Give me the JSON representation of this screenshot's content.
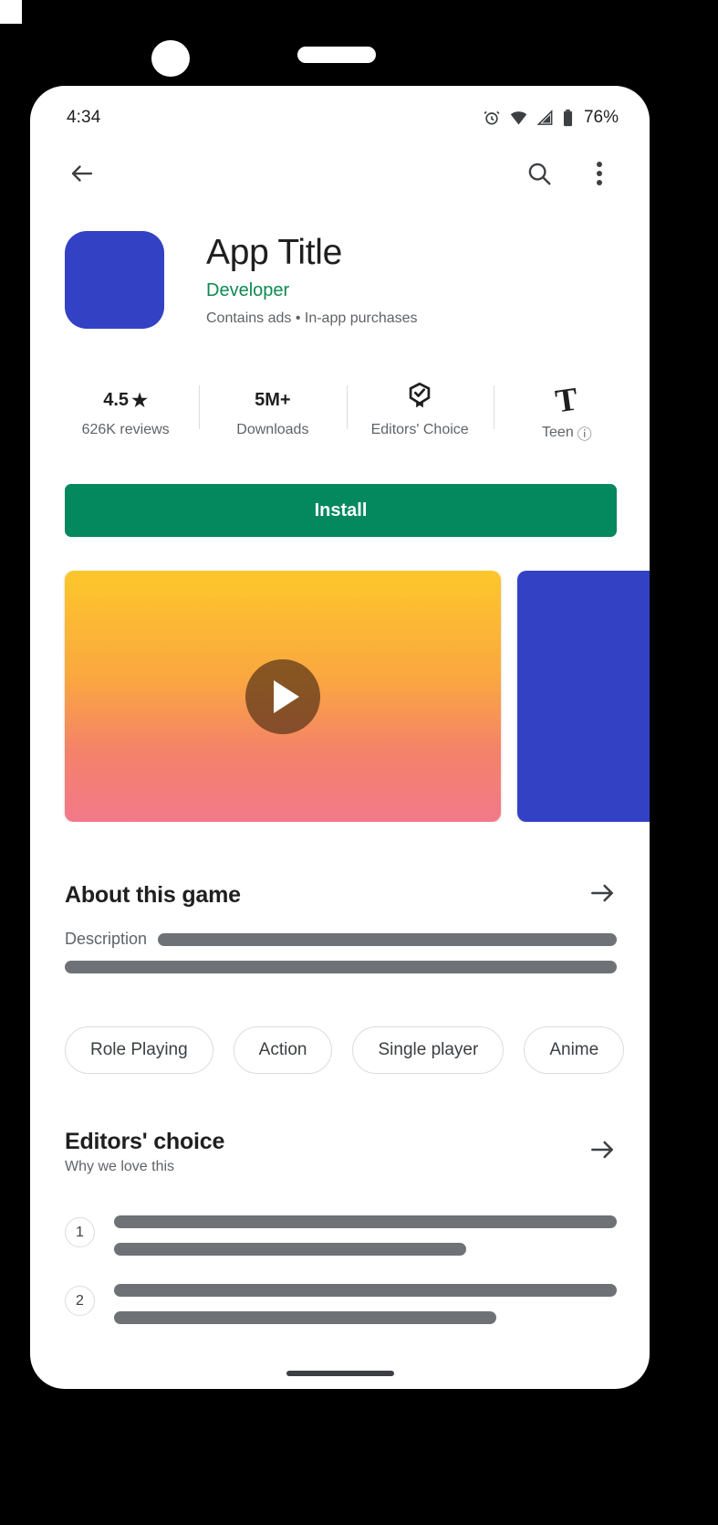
{
  "status_bar": {
    "time": "4:34",
    "battery_percent": "76%",
    "icons": [
      "alarm-icon",
      "wifi-icon",
      "cell-signal-icon",
      "battery-icon"
    ]
  },
  "action_bar": {
    "back_label": "Back",
    "search_label": "Search",
    "more_label": "More options"
  },
  "app": {
    "title": "App Title",
    "developer": "Developer",
    "subtitle": "Contains ads  •  In-app purchases",
    "icon_color": "#3341C4"
  },
  "stats": [
    {
      "value": "4.5",
      "star": "★",
      "label": "626K reviews",
      "type": "rating"
    },
    {
      "value": "5M+",
      "label": "Downloads",
      "type": "downloads"
    },
    {
      "value": "",
      "label": "Editors' Choice",
      "type": "award"
    },
    {
      "value": "T",
      "label": "Teen",
      "info": "ⓘ",
      "type": "content-rating"
    }
  ],
  "install": {
    "label": "Install",
    "color": "#04885E"
  },
  "media": [
    {
      "type": "video",
      "play_label": "Play trailer",
      "gradient_from": "#FDC72B",
      "gradient_to": "#F2798A"
    },
    {
      "type": "screenshot",
      "color": "#3341C4"
    }
  ],
  "about": {
    "title": "About this game",
    "arrow": "→",
    "description_label": "Description",
    "placeholder_lines": [
      1,
      1
    ]
  },
  "chips": [
    "Role Playing",
    "Action",
    "Single player",
    "Anime"
  ],
  "editors_choice": {
    "title": "Editors' choice",
    "subtitle": "Why we love this",
    "arrow": "→",
    "items": [
      {
        "number": "1",
        "lines": [
          100,
          70
        ]
      },
      {
        "number": "2",
        "lines": [
          100,
          76
        ]
      }
    ]
  }
}
